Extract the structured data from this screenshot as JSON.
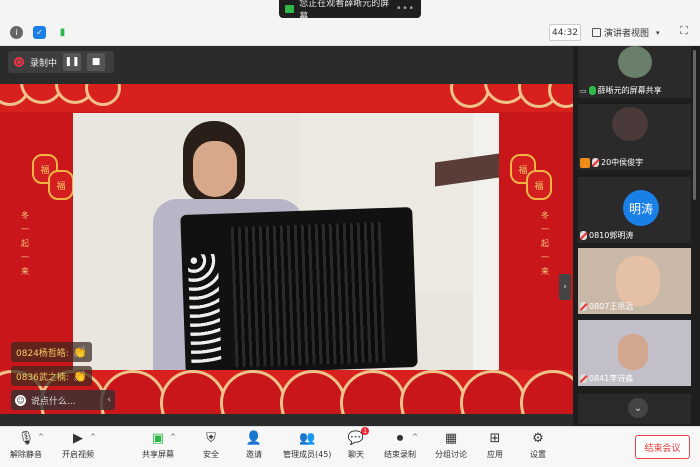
{
  "title_bar": {
    "sharing_text": "您正在观看薛晰元的屏幕"
  },
  "topbar": {
    "timer": "44:32",
    "view_label": "演讲者视图"
  },
  "recording": {
    "label": "录制中"
  },
  "chat": {
    "messages": [
      {
        "text": "0824杨哲皓:"
      },
      {
        "text": "0836武之楠:"
      }
    ],
    "input_placeholder": "说点什么..."
  },
  "banner": {
    "lantern_text": "福",
    "left_vertical": [
      "冬",
      "一",
      "起",
      "一",
      "来"
    ],
    "right_vertical": [
      "冬",
      "一",
      "起",
      "一",
      "来"
    ]
  },
  "participants": [
    {
      "name": "薛晰元的屏幕共享",
      "kind": "screen"
    },
    {
      "name": "20中侯俊宇",
      "kind": "photo"
    },
    {
      "name": "0810郭明涛",
      "kind": "avatar",
      "avatar_text": "明涛",
      "avatar_color": "#1a7fe6"
    },
    {
      "name": "0807王思远",
      "kind": "video"
    },
    {
      "name": "0841李诗淼",
      "kind": "video"
    }
  ],
  "toolbar": {
    "unmute": "解除静音",
    "video": "开启视频",
    "share": "共享屏幕",
    "security": "安全",
    "invite": "邀请",
    "members": "管理成员(45)",
    "chat": "聊天",
    "end_record": "结束录制",
    "breakout": "分组讨论",
    "apps": "应用",
    "settings": "设置",
    "end_meeting": "结束会议",
    "chat_badge": "1"
  },
  "colors": {
    "accent_red": "#c8161a",
    "end_red": "#e33",
    "avatar_blue": "#1a7fe6"
  }
}
